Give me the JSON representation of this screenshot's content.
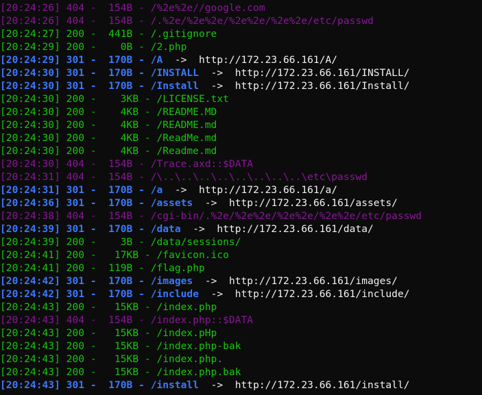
{
  "terminal": {
    "lines": [
      {
        "time": "[20:24:26]",
        "status": "404",
        "size": " 154B",
        "path": "/%2e%2e//google.com"
      },
      {
        "time": "[20:24:26]",
        "status": "404",
        "size": " 154B",
        "path": "/.%2e/%2e%2e/%2e%2e/%2e%2e/etc/passwd"
      },
      {
        "time": "[20:24:27]",
        "status": "200",
        "size": " 441B",
        "path": "/.gitignore"
      },
      {
        "time": "[20:24:29]",
        "status": "200",
        "size": "   0B",
        "path": "/2.php"
      },
      {
        "time": "[20:24:29]",
        "status": "301",
        "size": " 170B",
        "path": "/A",
        "redirect": "http://172.23.66.161/A/"
      },
      {
        "time": "[20:24:30]",
        "status": "301",
        "size": " 170B",
        "path": "/INSTALL",
        "redirect": "http://172.23.66.161/INSTALL/"
      },
      {
        "time": "[20:24:30]",
        "status": "301",
        "size": " 170B",
        "path": "/Install",
        "redirect": "http://172.23.66.161/Install/"
      },
      {
        "time": "[20:24:30]",
        "status": "200",
        "size": "   3KB",
        "path": "/LICENSE.txt"
      },
      {
        "time": "[20:24:30]",
        "status": "200",
        "size": "   4KB",
        "path": "/README.MD"
      },
      {
        "time": "[20:24:30]",
        "status": "200",
        "size": "   4KB",
        "path": "/README.md"
      },
      {
        "time": "[20:24:30]",
        "status": "200",
        "size": "   4KB",
        "path": "/ReadMe.md"
      },
      {
        "time": "[20:24:30]",
        "status": "200",
        "size": "   4KB",
        "path": "/Readme.md"
      },
      {
        "time": "[20:24:30]",
        "status": "404",
        "size": " 154B",
        "path": "/Trace.axd::$DATA"
      },
      {
        "time": "[20:24:31]",
        "status": "404",
        "size": " 154B",
        "path": "/\\..\\..\\..\\..\\..\\..\\..\\..\\etc\\passwd"
      },
      {
        "time": "[20:24:31]",
        "status": "301",
        "size": " 170B",
        "path": "/a",
        "redirect": "http://172.23.66.161/a/"
      },
      {
        "time": "[20:24:36]",
        "status": "301",
        "size": " 170B",
        "path": "/assets",
        "redirect": "http://172.23.66.161/assets/"
      },
      {
        "time": "[20:24:38]",
        "status": "404",
        "size": " 154B",
        "path": "/cgi-bin/.%2e/%2e%2e/%2e%2e/%2e%2e/etc/passwd"
      },
      {
        "time": "[20:24:39]",
        "status": "301",
        "size": " 170B",
        "path": "/data",
        "redirect": "http://172.23.66.161/data/"
      },
      {
        "time": "[20:24:39]",
        "status": "200",
        "size": "   3B",
        "path": "/data/sessions/"
      },
      {
        "time": "[20:24:41]",
        "status": "200",
        "size": "  17KB",
        "path": "/favicon.ico"
      },
      {
        "time": "[20:24:41]",
        "status": "200",
        "size": " 119B",
        "path": "/flag.php"
      },
      {
        "time": "[20:24:42]",
        "status": "301",
        "size": " 170B",
        "path": "/images",
        "redirect": "http://172.23.66.161/images/"
      },
      {
        "time": "[20:24:42]",
        "status": "301",
        "size": " 170B",
        "path": "/include",
        "redirect": "http://172.23.66.161/include/"
      },
      {
        "time": "[20:24:43]",
        "status": "200",
        "size": "  15KB",
        "path": "/index.php"
      },
      {
        "time": "[20:24:43]",
        "status": "404",
        "size": " 154B",
        "path": "/index.php::$DATA"
      },
      {
        "time": "[20:24:43]",
        "status": "200",
        "size": "  15KB",
        "path": "/index.pHp"
      },
      {
        "time": "[20:24:43]",
        "status": "200",
        "size": "  15KB",
        "path": "/index.php-bak"
      },
      {
        "time": "[20:24:43]",
        "status": "200",
        "size": "  15KB",
        "path": "/index.php."
      },
      {
        "time": "[20:24:43]",
        "status": "200",
        "size": "  15KB",
        "path": "/index.php.bak"
      },
      {
        "time": "[20:24:43]",
        "status": "301",
        "size": " 170B",
        "path": "/install",
        "redirect": "http://172.23.66.161/install/"
      }
    ],
    "separator": " - ",
    "arrow": "->",
    "colors": {
      "ok": "#16c60c",
      "not_found": "#881798",
      "redirect": "#3b78ff",
      "url": "#f2f2f2",
      "background": "#0c0c0c"
    }
  }
}
